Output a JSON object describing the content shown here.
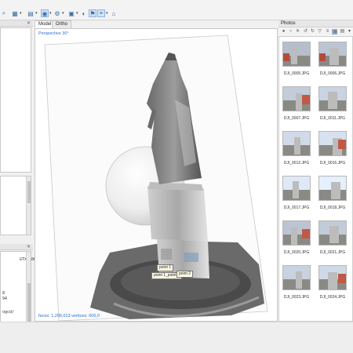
{
  "viewport": {
    "tabs": [
      {
        "label": "Model"
      },
      {
        "label": "Ortho"
      }
    ],
    "perspective_label": "Perspective 30°",
    "stats_label": "faces: 1,206,013 vertices: 606,0",
    "markers": [
      {
        "label": "point 1"
      },
      {
        "label": "point 1_point 2"
      },
      {
        "label": "point 2"
      }
    ]
  },
  "console": {
    "lines": [
      "GTX 1060",
      "8",
      "94",
      "ogcd/"
    ]
  },
  "photos": {
    "title": "Photos",
    "items": [
      {
        "caption": "DJI_0005.JPG"
      },
      {
        "caption": "DJI_0006.JPG"
      },
      {
        "caption": "DJI_0007.JPG"
      },
      {
        "caption": "DJI_0011.JPG"
      },
      {
        "caption": "DJI_0012.JPG"
      },
      {
        "caption": "DJI_0016.JPG"
      },
      {
        "caption": "DJI_0017.JPG"
      },
      {
        "caption": "DJI_0018.JPG"
      },
      {
        "caption": "DJI_0020.JPG"
      },
      {
        "caption": "DJI_0021.JPG"
      },
      {
        "caption": "DJI_0023.JPG"
      },
      {
        "caption": "DJI_0024.JPG"
      }
    ]
  },
  "colors": {
    "accent": "#2f6fd0",
    "selection": "#cfe3fb"
  }
}
